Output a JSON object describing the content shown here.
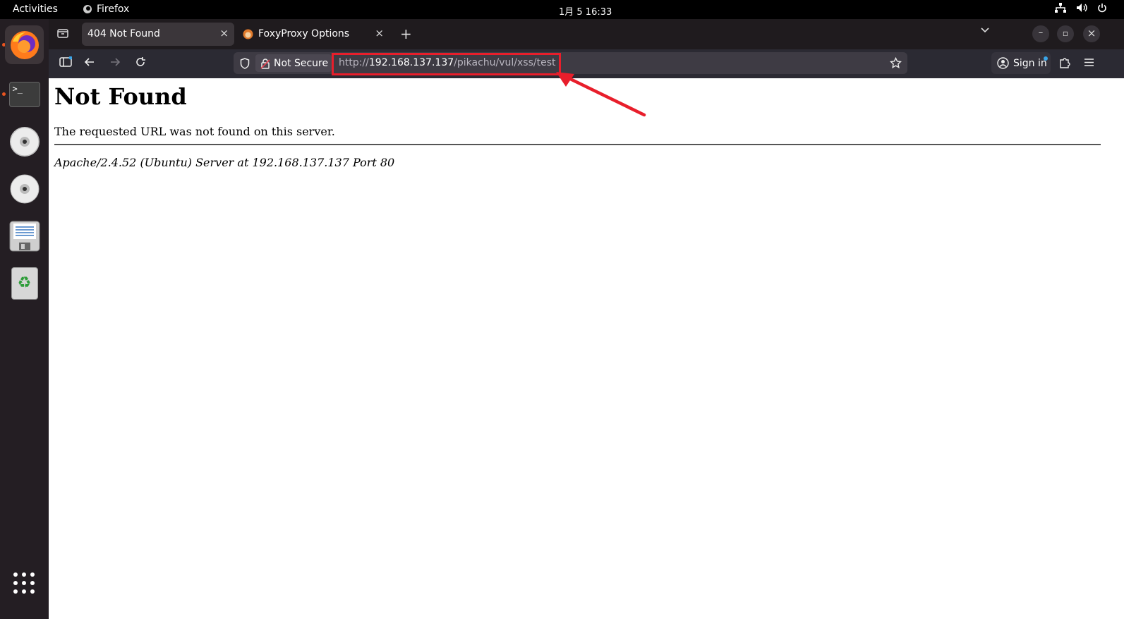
{
  "topbar": {
    "activities": "Activities",
    "app_name": "Firefox",
    "clock": "1月 5  16:33"
  },
  "dock": {
    "items": [
      {
        "name": "firefox"
      },
      {
        "name": "terminal",
        "glyph": ">_"
      },
      {
        "name": "cd-drive"
      },
      {
        "name": "cd-drive"
      },
      {
        "name": "floppy"
      },
      {
        "name": "trash",
        "glyph": "♻"
      }
    ],
    "apps_grid_glyph": "grid"
  },
  "tabs": [
    {
      "label": "404 Not Found",
      "active": true,
      "close": "×"
    },
    {
      "label": "FoxyProxy Options",
      "active": false,
      "close": "×"
    }
  ],
  "tabbar": {
    "new_tab": "+",
    "list_tabs": "⌄"
  },
  "window_controls": {
    "minimize": "–",
    "restore": "▫",
    "close": "×"
  },
  "navbar": {
    "not_secure": "Not Secure",
    "url_scheme": "http://",
    "url_host": "192.168.137.137",
    "url_path": "/pikachu/vul/xss/test",
    "sign_in": "Sign in"
  },
  "page": {
    "heading": "Not Found",
    "message": "The requested URL was not found on this server.",
    "server_signature": "Apache/2.4.52 (Ubuntu) Server at 192.168.137.137 Port 80"
  },
  "colors": {
    "annotation": "#e81e2b",
    "accent": "#e95420"
  }
}
